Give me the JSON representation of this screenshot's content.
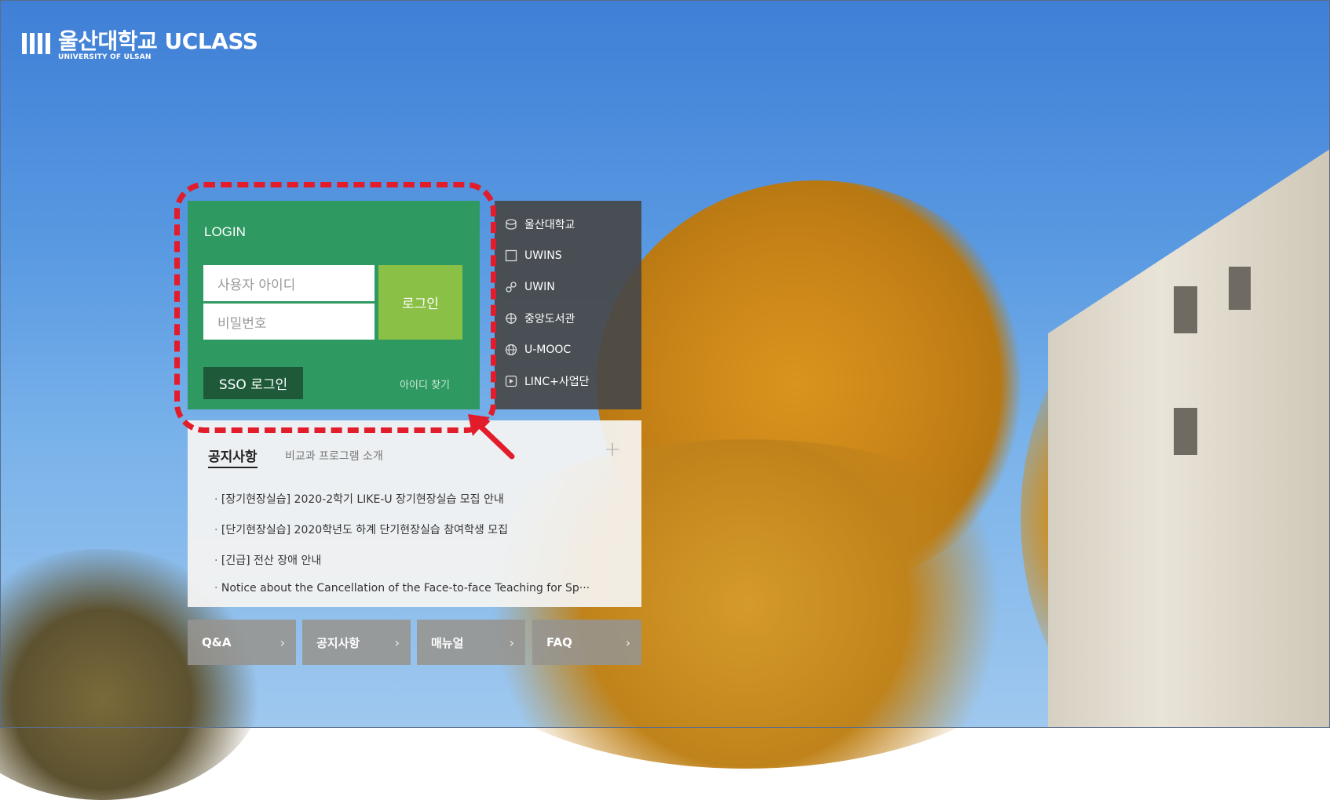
{
  "logo": {
    "main": "울산대학교 UCLASS",
    "sub": "UNIVERSITY OF ULSAN"
  },
  "login": {
    "title": "LOGIN",
    "id_placeholder": "사용자 아이디",
    "pw_placeholder": "비밀번호",
    "login_button": "로그인",
    "sso_button": "SSO 로그인",
    "find_id": "아이디 찾기"
  },
  "side_links": [
    {
      "label": "울산대학교",
      "icon": "university-icon"
    },
    {
      "label": "UWINS",
      "icon": "window-icon"
    },
    {
      "label": "UWIN",
      "icon": "link-icon"
    },
    {
      "label": "중앙도서관",
      "icon": "crosshair-icon"
    },
    {
      "label": "U-MOOC",
      "icon": "globe-icon"
    },
    {
      "label": "LINC+사업단",
      "icon": "play-icon"
    }
  ],
  "notice": {
    "tab_active": "공지사항",
    "tab_inactive": "비교과 프로그램 소개",
    "items": [
      "[장기현장실습] 2020-2학기 LIKE-U 장기현장실습 모집 안내",
      "[단기현장실습] 2020학년도 하계 단기현장실습 참여학생 모집",
      "[긴급] 전산 장애 안내",
      "Notice about the Cancellation of the Face-to-face Teaching for Sp···"
    ]
  },
  "quick_links": [
    {
      "label": "Q&A"
    },
    {
      "label": "공지사항"
    },
    {
      "label": "매뉴얼"
    },
    {
      "label": "FAQ"
    }
  ],
  "colors": {
    "login_green": "#2e9a61",
    "login_button": "#8ac045",
    "sso_button": "#1e5a3a",
    "highlight_red": "#e21c2a"
  }
}
